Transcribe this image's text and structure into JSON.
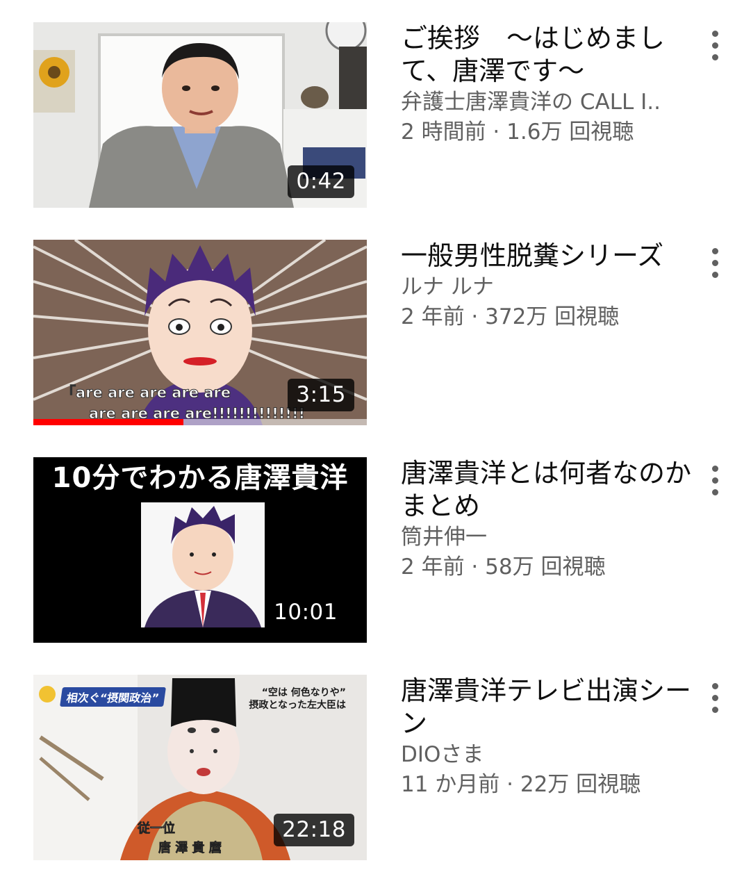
{
  "videos": [
    {
      "title": "ご挨拶　～はじめまして、唐澤です～",
      "channel": "弁護士唐澤貴洋の CALL I..",
      "stats": "2 時間前 · 1.6万 回視聴",
      "duration": "0:42"
    },
    {
      "title": "一般男性脱糞シリーズ",
      "channel": "ルナ ルナ",
      "stats": "2 年前 · 372万 回視聴",
      "duration": "3:15",
      "subtitle_line1": "「are are are are are",
      "subtitle_line2": "are are are are!!!!!!!!!!!!!!",
      "watch_progress": 0.45
    },
    {
      "title": "唐澤貴洋とは何者なのか　まとめ",
      "channel": "筒井伸一",
      "stats": "2 年前 · 58万 回視聴",
      "duration": "10:01",
      "thumbnail_banner": "10分でわかる唐澤貴洋"
    },
    {
      "title": "唐澤貴洋テレビ出演シーン",
      "channel": "DIOさま",
      "stats": "11 か月前 · 22万 回視聴",
      "duration": "22:18",
      "tv_tag": "相次ぐ“摂関政治”",
      "tv_caption_line1": "“空は 何色なりや”",
      "tv_caption_line2": "摂政となった左大臣は",
      "tv_name_line1": "従一位",
      "tv_name_line2": "唐 澤 貴 麿"
    }
  ],
  "colors": {
    "title": "#0f0f0f",
    "secondary": "#606060",
    "progress": "#ff0000"
  },
  "icons": {
    "menu": "more-vert-icon"
  }
}
